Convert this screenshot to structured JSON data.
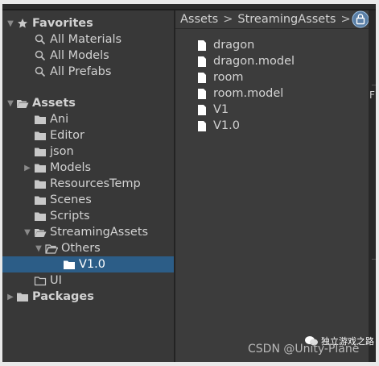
{
  "favorites": {
    "label": "Favorites",
    "items": [
      {
        "label": "All Materials"
      },
      {
        "label": "All Models"
      },
      {
        "label": "All Prefabs"
      }
    ]
  },
  "assets": {
    "label": "Assets",
    "folders": {
      "ani": "Ani",
      "editor": "Editor",
      "json": "json",
      "models": "Models",
      "resourcestemp": "ResourcesTemp",
      "scenes": "Scenes",
      "scripts": "Scripts",
      "streamingassets": "StreamingAssets",
      "others": "Others",
      "v10": "V1.0",
      "ui": "UI"
    }
  },
  "packages": {
    "label": "Packages"
  },
  "breadcrumb": {
    "root": "Assets",
    "current": "StreamingAssets",
    "separator": ">"
  },
  "files": [
    {
      "name": "dragon"
    },
    {
      "name": "dragon.model"
    },
    {
      "name": "room"
    },
    {
      "name": "room.model"
    },
    {
      "name": "V1"
    },
    {
      "name": "V1.0"
    }
  ],
  "edge_glyph": "F",
  "watermark": {
    "text": "独立游戏之路",
    "source": "CSDN @Unity-Plane"
  },
  "colors": {
    "selection": "#2c5d87",
    "panel": "#383838",
    "content": "#3c3c3c"
  }
}
